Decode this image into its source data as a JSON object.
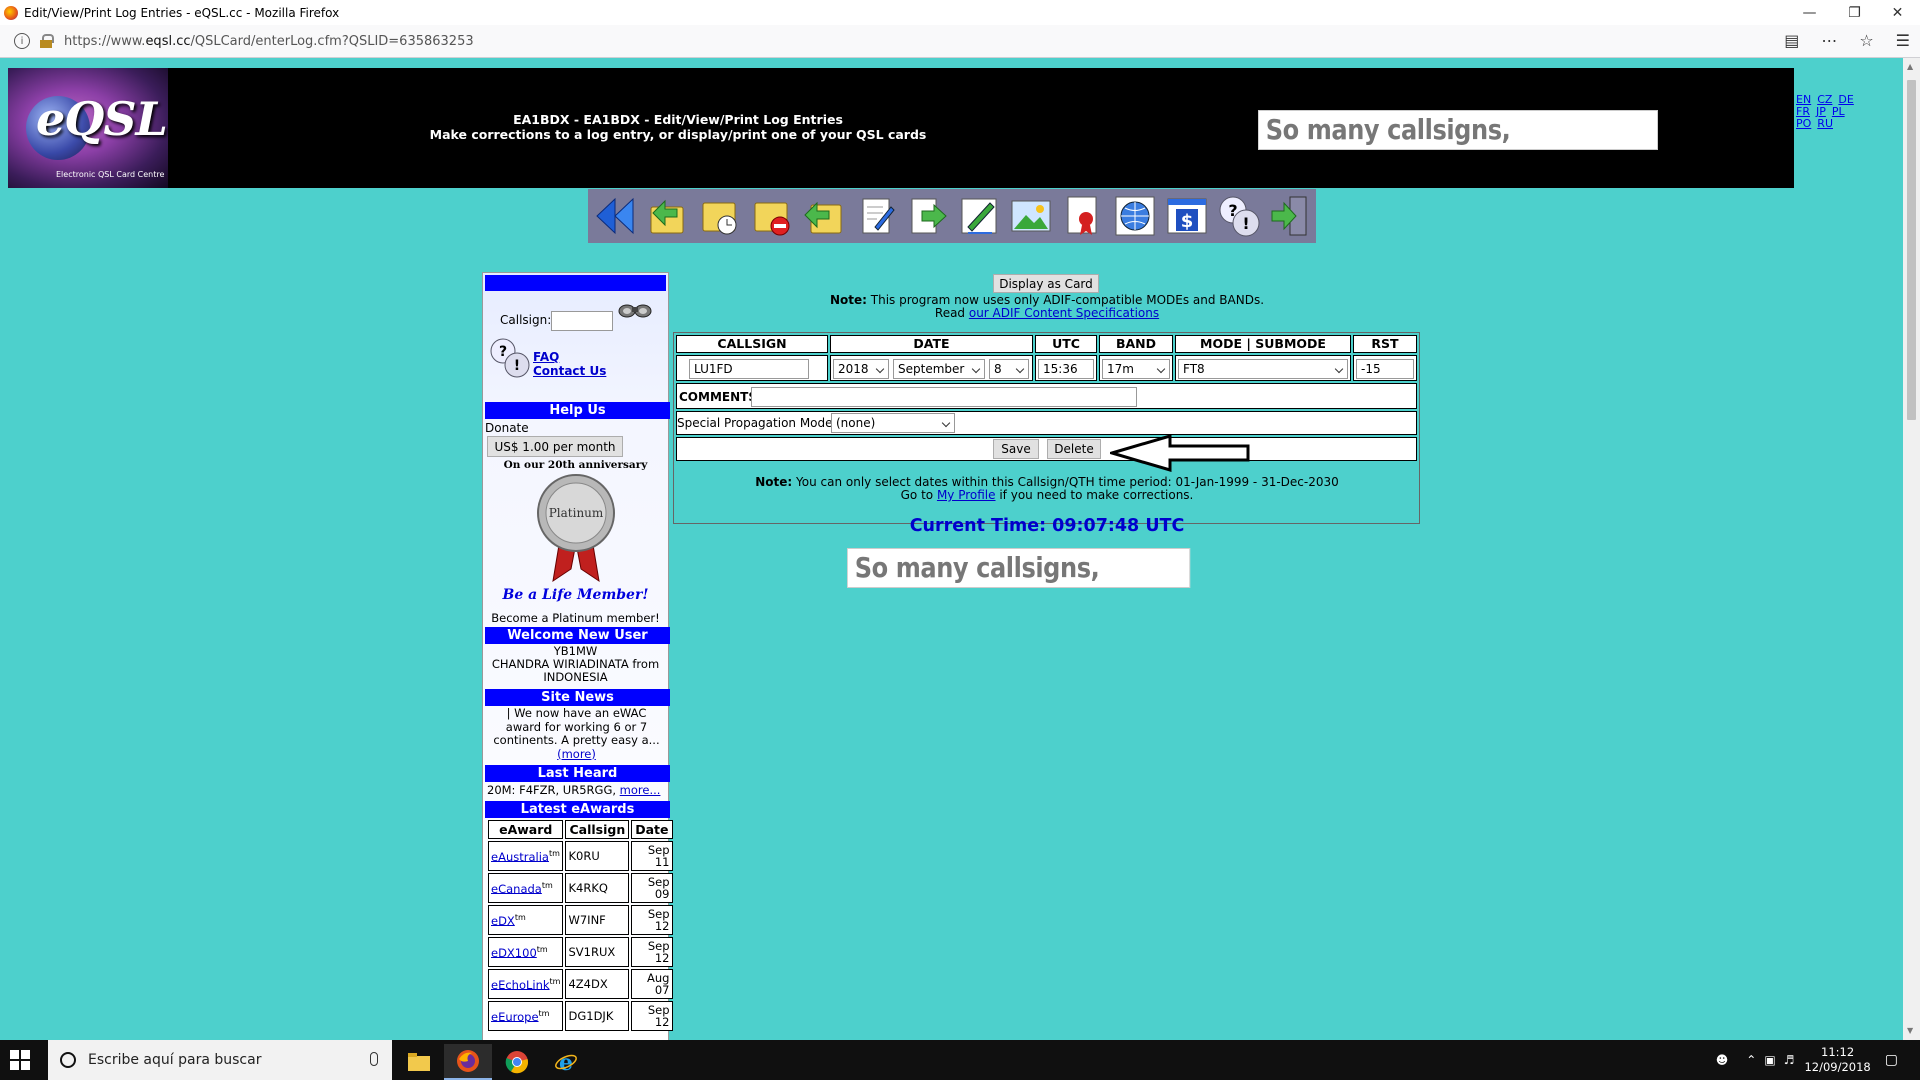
{
  "window": {
    "title": "Edit/View/Print Log Entries - eQSL.cc - Mozilla Firefox",
    "url_prefix": "https://www.",
    "url_domain": "eqsl.cc",
    "url_path": "/QSLCard/enterLog.cfm?QSLID=635863253"
  },
  "header": {
    "logo_word": "eQSL",
    "logo_tagline": "Electronic QSL Card Centre",
    "line1": "EA1BDX - EA1BDX - Edit/View/Print Log Entries",
    "line2": "Make corrections to a log entry, or display/print one of your QSL cards",
    "banner_text": "So many callsigns,",
    "languages": [
      [
        "EN",
        "CZ",
        "DE"
      ],
      [
        "FR",
        "JP",
        "PL"
      ],
      [
        "PO",
        "RU"
      ]
    ]
  },
  "toolbar": {
    "icons": [
      "back-icon",
      "upload-folder-icon",
      "folder-clock-icon",
      "folder-delete-icon",
      "download-folder-icon",
      "edit-document-icon",
      "export-icon",
      "pen-icon",
      "picture-icon",
      "award-ribbon-icon",
      "globe-icon",
      "dollar-icon",
      "help-icon",
      "exit-icon"
    ]
  },
  "sidebar": {
    "callsign_label": "Callsign:",
    "faq": "FAQ",
    "contact": "Contact Us",
    "help_us": "Help Us",
    "donate": "Donate",
    "donate_button": "US$ 1.00 per month",
    "anniversary": "On our 20th anniversary",
    "medal_text": "Platinum",
    "life_member": "Be a Life Member!",
    "platinum_line": "Become a Platinum member!",
    "welcome_title": "Welcome New User",
    "new_user_call": "YB1MW",
    "new_user_name": "CHANDRA WIRIADINATA from",
    "new_user_country": "INDONESIA",
    "site_news_title": "Site News",
    "site_news_text": "| We now have an eWAC award for working 6 or 7 continents. A pretty easy a...",
    "more": "(more)",
    "last_heard_title": "Last Heard",
    "last_heard_text": "20M: F4FZR, UR5RGG, ",
    "last_heard_more": "more...",
    "latest_title": "Latest eAwards",
    "awards_headers": [
      "eAward",
      "Callsign",
      "Date"
    ],
    "awards": [
      {
        "award": "eAustralia",
        "call": "K0RU",
        "m": "Sep",
        "d": "11"
      },
      {
        "award": "eCanada",
        "call": "K4RKQ",
        "m": "Sep",
        "d": "09"
      },
      {
        "award": "eDX",
        "call": "W7INF",
        "m": "Sep",
        "d": "12"
      },
      {
        "award": "eDX100",
        "call": "SV1RUX",
        "m": "Sep",
        "d": "12"
      },
      {
        "award": "eEchoLink",
        "call": "4Z4DX",
        "m": "Aug",
        "d": "07"
      },
      {
        "award": "eEurope",
        "call": "DG1DJK",
        "m": "Sep",
        "d": "12"
      }
    ],
    "tm": "tm"
  },
  "main": {
    "display_button": "Display as Card",
    "note_label": "Note:",
    "note1": " This program now uses only ADIF-compatible MODEs and BANDs.",
    "read": "Read ",
    "adif_link": "our ADIF Content Specifications",
    "headers": [
      "CALLSIGN",
      "DATE",
      "UTC",
      "BAND",
      "MODE | SUBMODE",
      "RST"
    ],
    "callsign": "LU1FD",
    "year": "2018",
    "month": "September",
    "day": "8",
    "utc": "15:36",
    "band": "17m",
    "mode": "FT8",
    "rst": "-15",
    "comments_label": "COMMENTS",
    "comments": "",
    "prop_label": "Special Propagation Mode",
    "prop_value": "(none)",
    "save": "Save",
    "delete": "Delete",
    "note2": " You can only select dates within this Callsign/QTH time period: 01-Jan-1999 - 31-Dec-2030",
    "goto": "Go to ",
    "profile_link": "My Profile",
    "goto_tail": " if you need to make corrections.",
    "current_time": "Current Time: 09:07:48 UTC",
    "banner_text": "So many callsigns,"
  },
  "taskbar": {
    "search_placeholder": "Escribe aquí para buscar",
    "time": "11:12",
    "date": "12/09/2018"
  },
  "colors": {
    "page_bg": "#4dd0cc",
    "header_bg": "#000000",
    "section_bar": "#0000ff",
    "current_time": "#0000cc"
  }
}
